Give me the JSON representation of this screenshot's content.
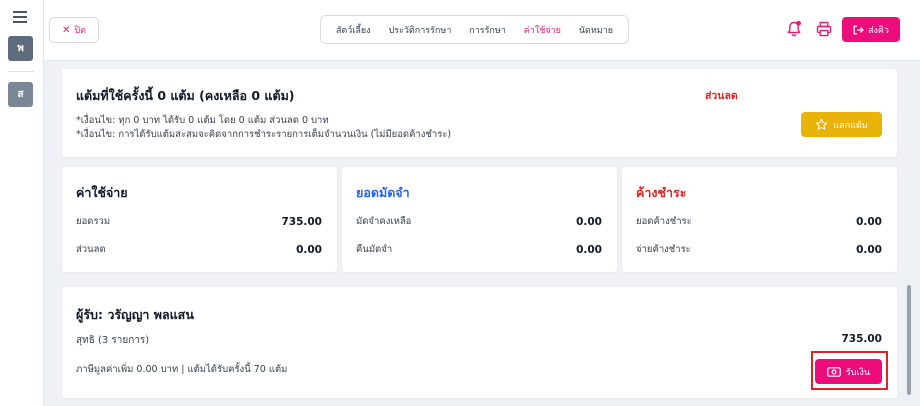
{
  "sidebar": {
    "avatar_letter": "พ",
    "second_letter": "ส"
  },
  "header": {
    "close_label": "ปิด",
    "tabs": [
      {
        "label": "สัตว์เลี้ยง"
      },
      {
        "label": "ประวัติการรักษา"
      },
      {
        "label": "การรักษา"
      },
      {
        "label": "ค่าใช้จ่าย",
        "active": true
      },
      {
        "label": "นัดหมาย"
      }
    ],
    "send_label": "ส่งคิว"
  },
  "points": {
    "title": "แต้มที่ใช้ครั้งนี้ 0 แต้ม (คงเหลือ 0 แต้ม)",
    "discount_label": "ส่วนลด",
    "condition_1": "*เงื่อนไข: ทุก 0 บาท ได้รับ 0 แต้ม โดย 0 แต้ม ส่วนลด 0 บาท",
    "condition_2": "*เงื่อนไข: การได้รับแต้มสะสมจะคิดจากการชำระรายการเต็มจำนวนเงิน (ไม่มียอดค้างชำระ)",
    "redeem_label": "แลกแต้ม"
  },
  "expenses": {
    "title": "ค่าใช้จ่าย",
    "total_label": "ยอดรวม",
    "total_value": "735.00",
    "discount_label": "ส่วนลด",
    "discount_value": "0.00"
  },
  "deposit": {
    "title": "ยอดมัดจำ",
    "remaining_label": "มัดจำคงเหลือ",
    "remaining_value": "0.00",
    "refund_label": "คืนมัดจำ",
    "refund_value": "0.00"
  },
  "outstanding": {
    "title": "ค้างชำระ",
    "outstanding_label": "ยอดค้างชำระ",
    "outstanding_value": "0.00",
    "pay_label": "จ่ายค้างชำระ",
    "pay_value": "0.00"
  },
  "receiver": {
    "title": "ผู้รับ: วรัญญา พลแสน",
    "net_label": "สุทธิ (3 รายการ)",
    "net_value": "735.00",
    "vat_text": "ภาษีมูลค่าเพิ่ม 0.00 บาท | แต้มได้รับครั้งนี้ 70 แต้ม",
    "receive_label": "รับเงิน"
  },
  "colors": {
    "accent": "#ec0c7c",
    "deposit_title": "#2563eb",
    "outstanding_title": "#dc2626",
    "redeem": "#eab308"
  }
}
